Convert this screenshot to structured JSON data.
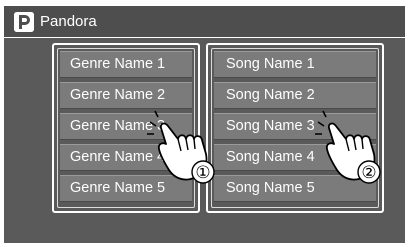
{
  "app": {
    "title": "Pandora",
    "icon": "pandora-logo-icon"
  },
  "genres": {
    "items": [
      {
        "label": "Genre Name 1"
      },
      {
        "label": "Genre Name 2"
      },
      {
        "label": "Genre Name 3"
      },
      {
        "label": "Genre Name 4"
      },
      {
        "label": "Genre Name 5"
      }
    ]
  },
  "songs": {
    "items": [
      {
        "label": "Song Name 1"
      },
      {
        "label": "Song Name 2"
      },
      {
        "label": "Song Name 3"
      },
      {
        "label": "Song Name 4"
      },
      {
        "label": "Song Name 5"
      }
    ]
  },
  "callouts": [
    {
      "label": "①",
      "icon": "tapping-hand-icon"
    },
    {
      "label": "②",
      "icon": "tapping-hand-icon"
    }
  ],
  "colors": {
    "background": "#5a5a5a",
    "titlebar": "#4e4e4e",
    "item": "#7b7b7b",
    "text": "#ffffff"
  }
}
